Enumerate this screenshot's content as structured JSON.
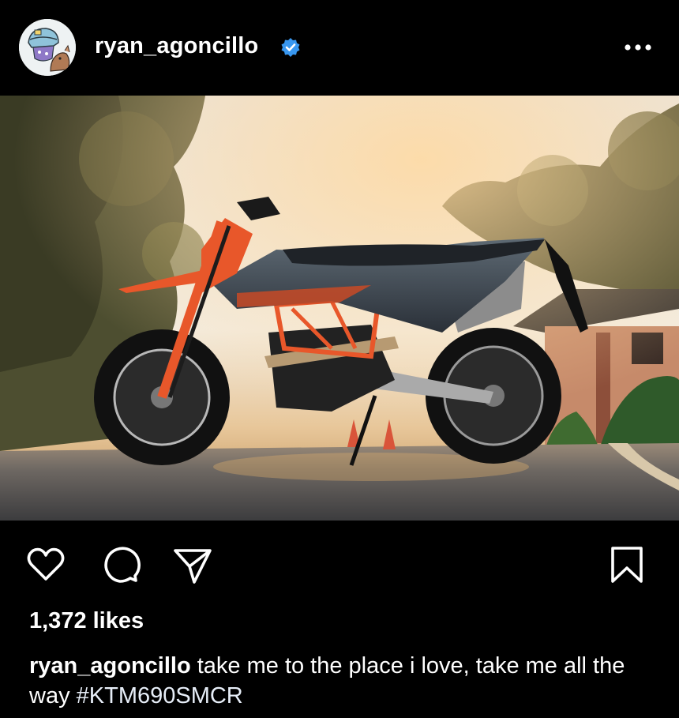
{
  "post": {
    "username": "ryan_agoncillo",
    "verified_icon": "verified-badge-icon",
    "more_icon": "more-options-icon",
    "photo_alt": "KTM 690 SMC R motorcycle",
    "likes": "1,372 likes",
    "caption_user": "ryan_agoncillo",
    "caption_text": " take me to the place i love, take me all the way ",
    "caption_hashtag": "#KTM690SMCR"
  },
  "actions": {
    "like_icon": "heart-icon",
    "comment_icon": "comment-icon",
    "share_icon": "share-icon",
    "save_icon": "bookmark-icon"
  },
  "colors": {
    "background": "#000000",
    "verified": "#3897f0",
    "bike_accent": "#e8572a"
  }
}
